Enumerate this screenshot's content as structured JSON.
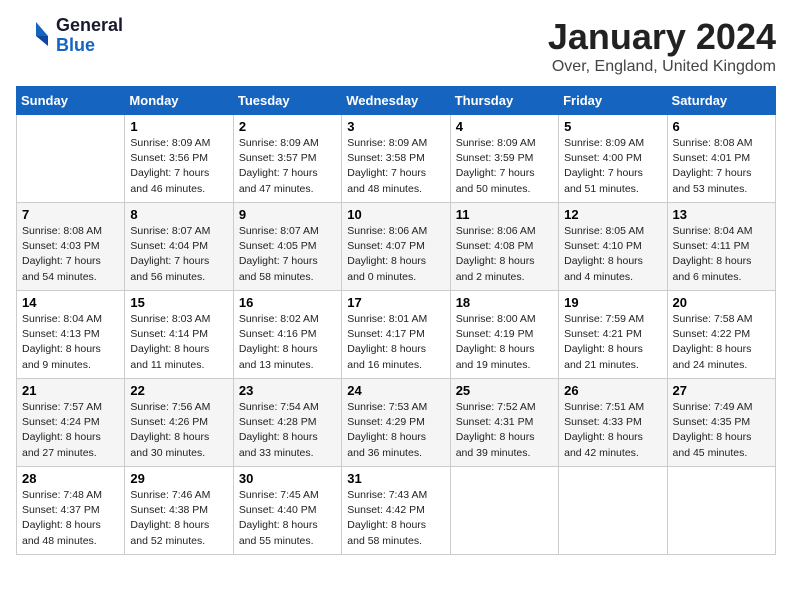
{
  "logo": {
    "line1": "General",
    "line2": "Blue"
  },
  "title": "January 2024",
  "location": "Over, England, United Kingdom",
  "days_of_week": [
    "Sunday",
    "Monday",
    "Tuesday",
    "Wednesday",
    "Thursday",
    "Friday",
    "Saturday"
  ],
  "weeks": [
    [
      {
        "day": null
      },
      {
        "day": "1",
        "sunrise": "8:09 AM",
        "sunset": "3:56 PM",
        "daylight": "7 hours and 46 minutes."
      },
      {
        "day": "2",
        "sunrise": "8:09 AM",
        "sunset": "3:57 PM",
        "daylight": "7 hours and 47 minutes."
      },
      {
        "day": "3",
        "sunrise": "8:09 AM",
        "sunset": "3:58 PM",
        "daylight": "7 hours and 48 minutes."
      },
      {
        "day": "4",
        "sunrise": "8:09 AM",
        "sunset": "3:59 PM",
        "daylight": "7 hours and 50 minutes."
      },
      {
        "day": "5",
        "sunrise": "8:09 AM",
        "sunset": "4:00 PM",
        "daylight": "7 hours and 51 minutes."
      },
      {
        "day": "6",
        "sunrise": "8:08 AM",
        "sunset": "4:01 PM",
        "daylight": "7 hours and 53 minutes."
      }
    ],
    [
      {
        "day": "7",
        "sunrise": "8:08 AM",
        "sunset": "4:03 PM",
        "daylight": "7 hours and 54 minutes."
      },
      {
        "day": "8",
        "sunrise": "8:07 AM",
        "sunset": "4:04 PM",
        "daylight": "7 hours and 56 minutes."
      },
      {
        "day": "9",
        "sunrise": "8:07 AM",
        "sunset": "4:05 PM",
        "daylight": "7 hours and 58 minutes."
      },
      {
        "day": "10",
        "sunrise": "8:06 AM",
        "sunset": "4:07 PM",
        "daylight": "8 hours and 0 minutes."
      },
      {
        "day": "11",
        "sunrise": "8:06 AM",
        "sunset": "4:08 PM",
        "daylight": "8 hours and 2 minutes."
      },
      {
        "day": "12",
        "sunrise": "8:05 AM",
        "sunset": "4:10 PM",
        "daylight": "8 hours and 4 minutes."
      },
      {
        "day": "13",
        "sunrise": "8:04 AM",
        "sunset": "4:11 PM",
        "daylight": "8 hours and 6 minutes."
      }
    ],
    [
      {
        "day": "14",
        "sunrise": "8:04 AM",
        "sunset": "4:13 PM",
        "daylight": "8 hours and 9 minutes."
      },
      {
        "day": "15",
        "sunrise": "8:03 AM",
        "sunset": "4:14 PM",
        "daylight": "8 hours and 11 minutes."
      },
      {
        "day": "16",
        "sunrise": "8:02 AM",
        "sunset": "4:16 PM",
        "daylight": "8 hours and 13 minutes."
      },
      {
        "day": "17",
        "sunrise": "8:01 AM",
        "sunset": "4:17 PM",
        "daylight": "8 hours and 16 minutes."
      },
      {
        "day": "18",
        "sunrise": "8:00 AM",
        "sunset": "4:19 PM",
        "daylight": "8 hours and 19 minutes."
      },
      {
        "day": "19",
        "sunrise": "7:59 AM",
        "sunset": "4:21 PM",
        "daylight": "8 hours and 21 minutes."
      },
      {
        "day": "20",
        "sunrise": "7:58 AM",
        "sunset": "4:22 PM",
        "daylight": "8 hours and 24 minutes."
      }
    ],
    [
      {
        "day": "21",
        "sunrise": "7:57 AM",
        "sunset": "4:24 PM",
        "daylight": "8 hours and 27 minutes."
      },
      {
        "day": "22",
        "sunrise": "7:56 AM",
        "sunset": "4:26 PM",
        "daylight": "8 hours and 30 minutes."
      },
      {
        "day": "23",
        "sunrise": "7:54 AM",
        "sunset": "4:28 PM",
        "daylight": "8 hours and 33 minutes."
      },
      {
        "day": "24",
        "sunrise": "7:53 AM",
        "sunset": "4:29 PM",
        "daylight": "8 hours and 36 minutes."
      },
      {
        "day": "25",
        "sunrise": "7:52 AM",
        "sunset": "4:31 PM",
        "daylight": "8 hours and 39 minutes."
      },
      {
        "day": "26",
        "sunrise": "7:51 AM",
        "sunset": "4:33 PM",
        "daylight": "8 hours and 42 minutes."
      },
      {
        "day": "27",
        "sunrise": "7:49 AM",
        "sunset": "4:35 PM",
        "daylight": "8 hours and 45 minutes."
      }
    ],
    [
      {
        "day": "28",
        "sunrise": "7:48 AM",
        "sunset": "4:37 PM",
        "daylight": "8 hours and 48 minutes."
      },
      {
        "day": "29",
        "sunrise": "7:46 AM",
        "sunset": "4:38 PM",
        "daylight": "8 hours and 52 minutes."
      },
      {
        "day": "30",
        "sunrise": "7:45 AM",
        "sunset": "4:40 PM",
        "daylight": "8 hours and 55 minutes."
      },
      {
        "day": "31",
        "sunrise": "7:43 AM",
        "sunset": "4:42 PM",
        "daylight": "8 hours and 58 minutes."
      },
      {
        "day": null
      },
      {
        "day": null
      },
      {
        "day": null
      }
    ]
  ]
}
